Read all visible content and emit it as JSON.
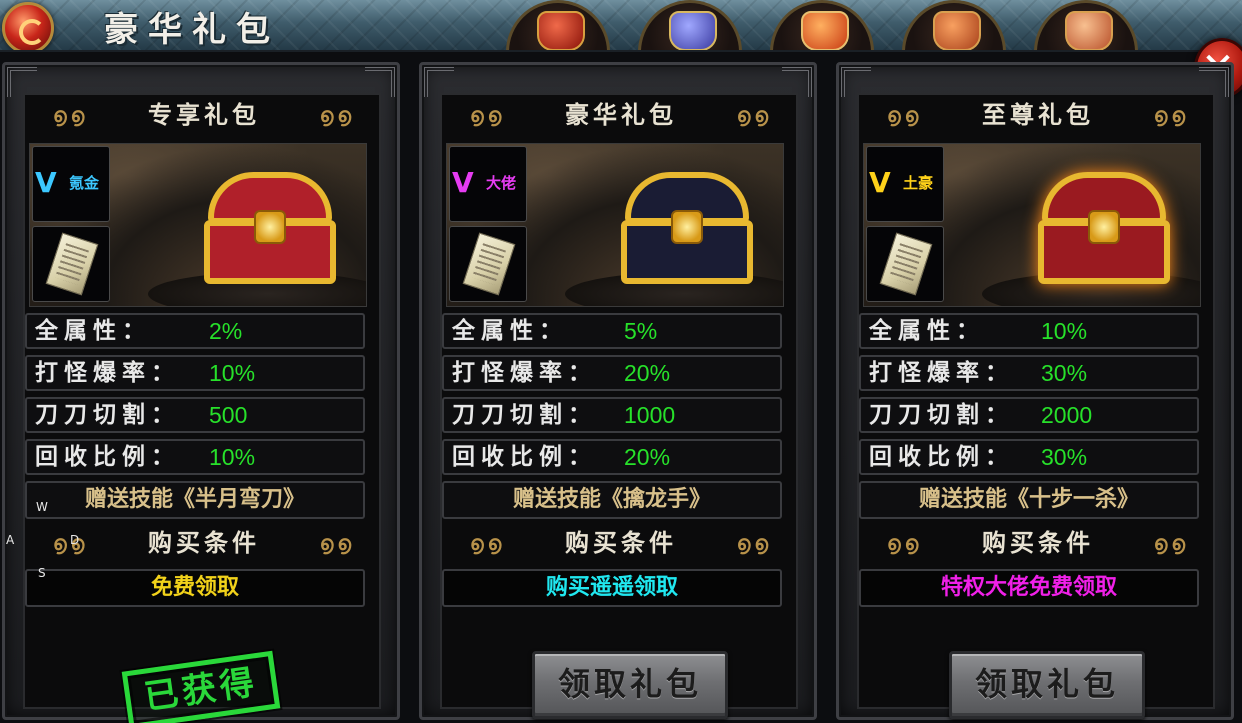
{
  "header": {
    "title": "豪华礼包",
    "tabs": [
      {
        "icon": "red-envelope-icon",
        "color": "#c8261a"
      },
      {
        "icon": "blue-pouch-icon",
        "color": "#5a5ac8"
      },
      {
        "icon": "red-bag-icon",
        "color": "#e0602a"
      },
      {
        "icon": "orange-pouch-icon",
        "color": "#d86a2a"
      },
      {
        "icon": "scroll-bundle-icon",
        "color": "#c86a3a"
      }
    ],
    "close_label": "✕"
  },
  "labels": {
    "attr": "全属性：",
    "drop": "打怪爆率：",
    "cut": "刀刀切割：",
    "recycle": "回收比例：",
    "condition_header": "购买条件"
  },
  "packs": [
    {
      "name": "专享礼包",
      "vip_label": "氪金",
      "vip_color": "#3cc8ff",
      "chest_accent": "#b0202a",
      "stats": {
        "attr": "2%",
        "drop": "10%",
        "cut": "500",
        "recycle": "10%"
      },
      "skill": "赠送技能《半月弯刀》",
      "condition": "免费领取",
      "condition_color": "#f2d21a",
      "status": "已获得"
    },
    {
      "name": "豪华礼包",
      "vip_label": "大佬",
      "vip_color": "#e63cf2",
      "chest_accent": "#1a1c34",
      "stats": {
        "attr": "5%",
        "drop": "20%",
        "cut": "1000",
        "recycle": "20%"
      },
      "skill": "赠送技能《擒龙手》",
      "condition": "购买遥遥领取",
      "condition_color": "#20e8f0",
      "button": "领取礼包"
    },
    {
      "name": "至尊礼包",
      "vip_label": "土豪",
      "vip_color": "#ffd21a",
      "chest_accent": "#9a1a20",
      "stats": {
        "attr": "10%",
        "drop": "30%",
        "cut": "2000",
        "recycle": "30%"
      },
      "skill": "赠送技能《十步一杀》",
      "condition": "特权大佬免费领取",
      "condition_color": "#f020e8",
      "button": "领取礼包"
    }
  ],
  "debug_keys": [
    "W",
    "A",
    "D",
    "S"
  ]
}
